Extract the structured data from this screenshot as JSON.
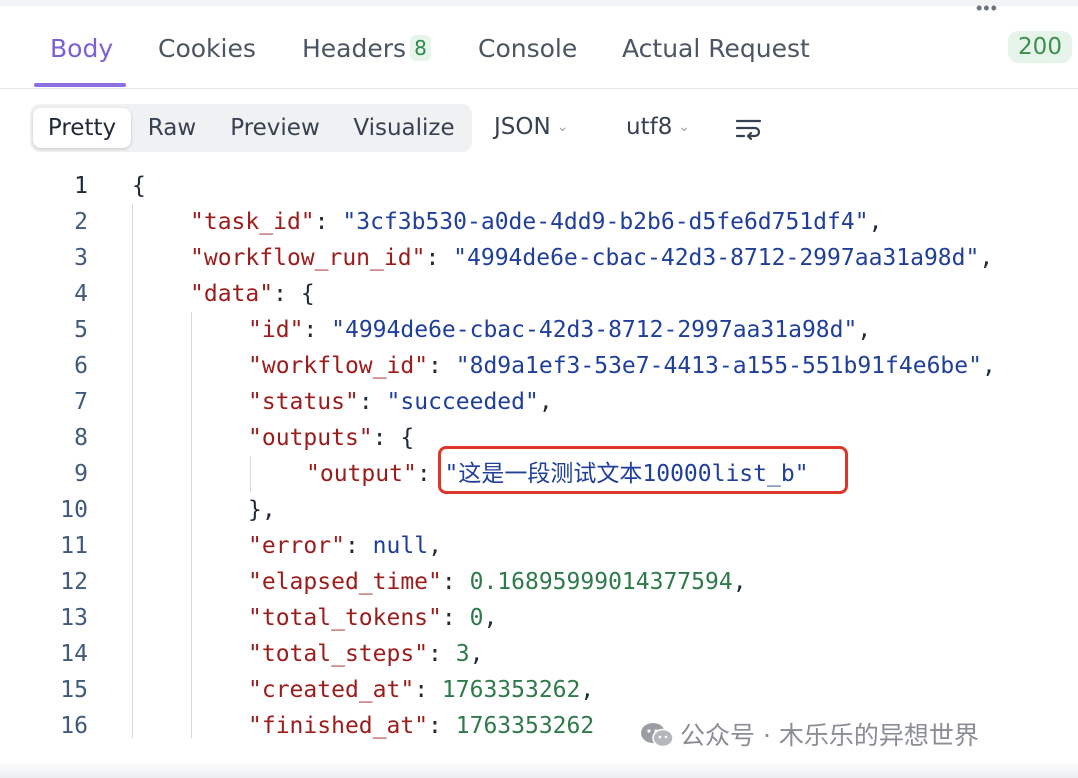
{
  "tabs": [
    {
      "label": "Body",
      "active": true
    },
    {
      "label": "Cookies"
    },
    {
      "label": "Headers",
      "badge": "8"
    },
    {
      "label": "Console"
    },
    {
      "label": "Actual Request"
    }
  ],
  "status_code": "200",
  "view_modes": [
    "Pretty",
    "Raw",
    "Preview",
    "Visualize"
  ],
  "active_view_mode": "Pretty",
  "format_dropdown": "JSON",
  "encoding_dropdown": "utf8",
  "wrap_icon": "wrap-lines-icon",
  "code_lines": [
    {
      "num": "1",
      "text": "{"
    },
    {
      "num": "2",
      "key": "task_id",
      "value": "3cf3b530-a0de-4dd9-b2b6-d5fe6d751df4"
    },
    {
      "num": "3",
      "key": "workflow_run_id",
      "value": "4994de6e-cbac-42d3-8712-2997aa31a98d"
    },
    {
      "num": "4",
      "key": "data",
      "open": "{"
    },
    {
      "num": "5",
      "key": "id",
      "value": "4994de6e-cbac-42d3-8712-2997aa31a98d"
    },
    {
      "num": "6",
      "key": "workflow_id",
      "value": "8d9a1ef3-53e7-4413-a155-551b91f4e6be"
    },
    {
      "num": "7",
      "key": "status",
      "value": "succeeded"
    },
    {
      "num": "8",
      "key": "outputs",
      "open": "{"
    },
    {
      "num": "9",
      "key": "output",
      "value": "这是一段测试文本10000list_b"
    },
    {
      "num": "10",
      "text": "},"
    },
    {
      "num": "11",
      "key": "error",
      "value": "null"
    },
    {
      "num": "12",
      "key": "elapsed_time",
      "value": "0.16895999014377594"
    },
    {
      "num": "13",
      "key": "total_tokens",
      "value": "0"
    },
    {
      "num": "14",
      "key": "total_steps",
      "value": "3"
    },
    {
      "num": "15",
      "key": "created_at",
      "value": "1763353262"
    },
    {
      "num": "16",
      "key": "finished_at",
      "value": "1763353262"
    }
  ],
  "watermark": "公众号 · 木乐乐的异想世界",
  "colors": {
    "accent": "#8b6fe0",
    "key": "#9c1c1c",
    "string": "#1f3f9a",
    "number": "#2f7a4a",
    "highlight": "#e0352b"
  }
}
